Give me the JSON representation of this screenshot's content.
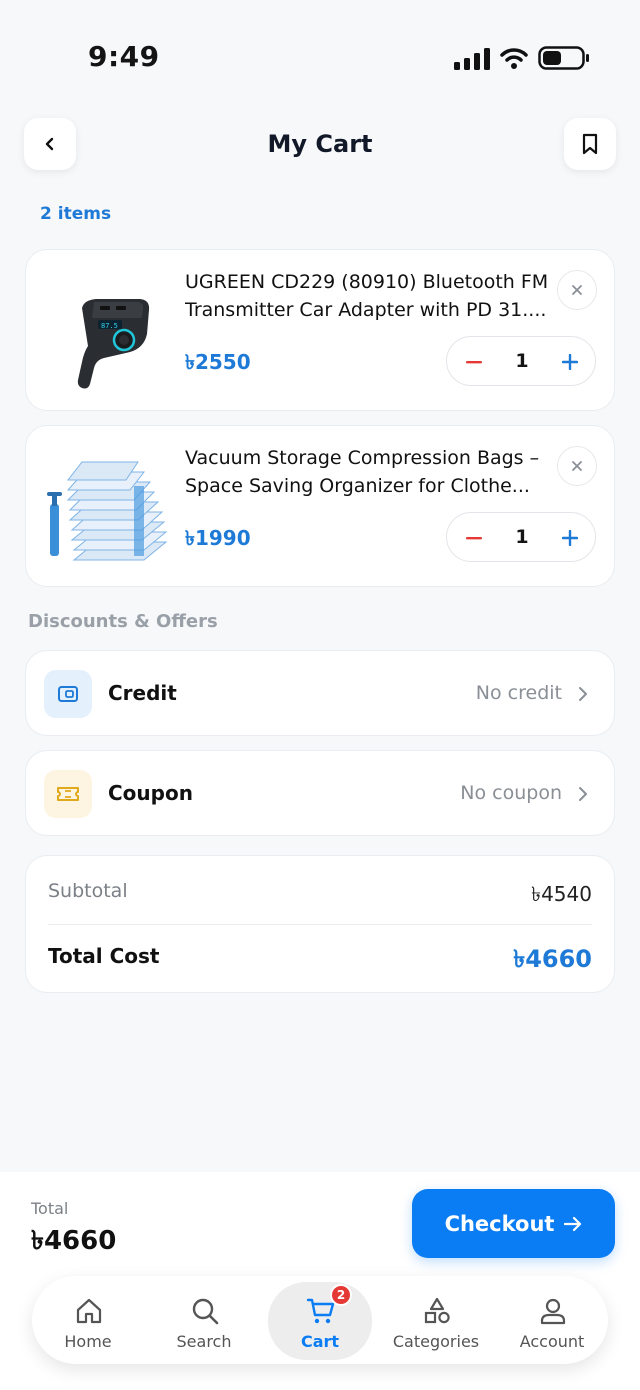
{
  "status": {
    "time": "9:49"
  },
  "header": {
    "title": "My Cart"
  },
  "cart": {
    "count_label": "2 items",
    "items": [
      {
        "title": "UGREEN CD229 (80910) Bluetooth FM Transmitter Car Adapter with PD 31....",
        "price": "৳2550",
        "qty": "1"
      },
      {
        "title": "Vacuum Storage Compression Bags – Space Saving Organizer for Clothe...",
        "price": "৳1990",
        "qty": "1"
      }
    ]
  },
  "offers": {
    "section_label": "Discounts & Offers",
    "credit": {
      "label": "Credit",
      "value": "No credit"
    },
    "coupon": {
      "label": "Coupon",
      "value": "No coupon"
    }
  },
  "summary": {
    "subtotal_label": "Subtotal",
    "subtotal_value": "৳4540",
    "total_label": "Total Cost",
    "total_value": "৳4660"
  },
  "footer": {
    "total_label": "Total",
    "total_value": "৳4660",
    "checkout_label": "Checkout"
  },
  "tabs": [
    {
      "label": "Home",
      "icon": "home-icon"
    },
    {
      "label": "Search",
      "icon": "search-icon"
    },
    {
      "label": "Cart",
      "icon": "cart-icon",
      "badge": "2",
      "active": true
    },
    {
      "label": "Categories",
      "icon": "categories-icon"
    },
    {
      "label": "Account",
      "icon": "account-icon"
    }
  ],
  "colors": {
    "accent": "#0a7df4",
    "price": "#1e7ad6",
    "badge": "#e53935",
    "minus": "#e53935"
  }
}
